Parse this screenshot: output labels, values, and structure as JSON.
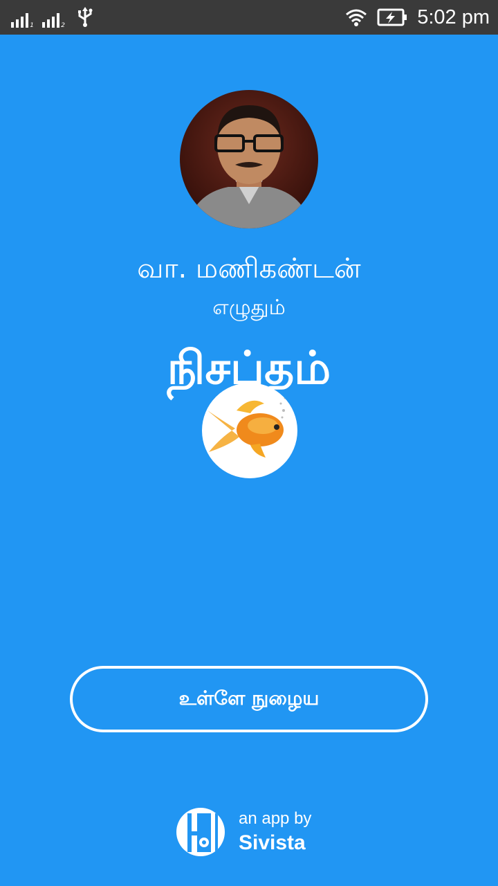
{
  "status_bar": {
    "time": "5:02 pm",
    "sim1_label": "1",
    "sim2_label": "2",
    "icons": [
      "signal-sim1-icon",
      "signal-sim2-icon",
      "usb-icon",
      "wifi-icon",
      "battery-charging-icon"
    ]
  },
  "profile": {
    "author_name": "வா. மணிகண்டன்",
    "writes_label": "எழுதும்",
    "app_title": "நிசப்தம்",
    "fish_logo_icon": "goldfish-icon"
  },
  "actions": {
    "enter_label": "உள்ளே நுழைய"
  },
  "credit": {
    "by_label": "an app by",
    "company": "Sivista",
    "logo_icon": "sivista-logo-icon"
  },
  "colors": {
    "background": "#2196F3",
    "status_bar": "#3a3a3a",
    "text": "#ffffff"
  }
}
